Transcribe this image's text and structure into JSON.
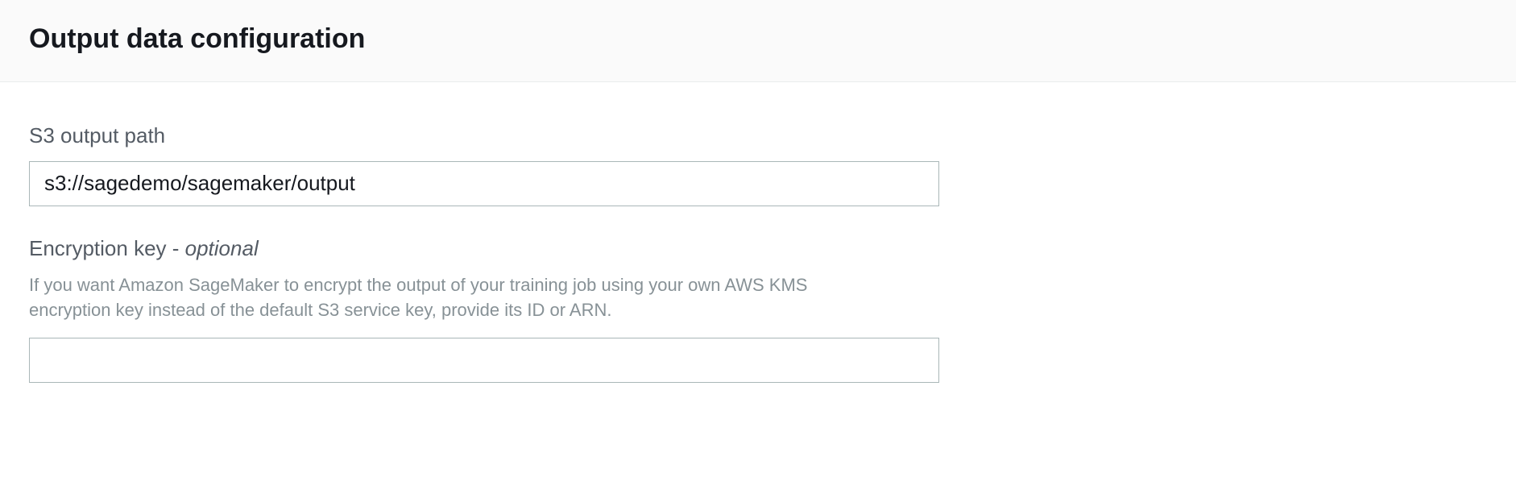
{
  "section": {
    "title": "Output data configuration"
  },
  "fields": {
    "s3_output": {
      "label": "S3 output path",
      "value": "s3://sagedemo/sagemaker/output"
    },
    "encryption_key": {
      "label_main": "Encryption key",
      "label_separator": " - ",
      "label_optional": "optional",
      "description": "If you want Amazon SageMaker to encrypt the output of your training job using your own AWS KMS encryption key instead of the default S3 service key, provide its ID or ARN.",
      "value": ""
    }
  }
}
